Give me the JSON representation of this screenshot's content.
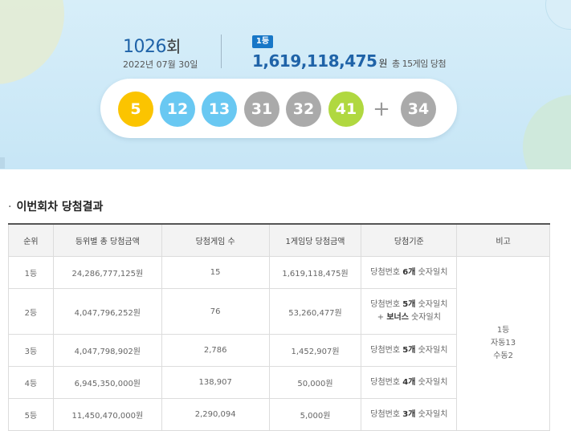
{
  "draw": {
    "number": "1026",
    "unit": "회",
    "date": "2022년 07월 30일"
  },
  "first_prize": {
    "badge": "1등",
    "amount": "1,619,118,475",
    "currency": "원",
    "games_text": "총 15게임 당첨"
  },
  "numbers": [
    {
      "value": "5",
      "color": "#fbc400"
    },
    {
      "value": "12",
      "color": "#69c8f2"
    },
    {
      "value": "13",
      "color": "#69c8f2"
    },
    {
      "value": "31",
      "color": "#aaaaaa"
    },
    {
      "value": "32",
      "color": "#aaaaaa"
    },
    {
      "value": "41",
      "color": "#b0d840"
    }
  ],
  "plus": "+",
  "bonus": {
    "value": "34",
    "color": "#aaaaaa"
  },
  "section_title": "이번회차 당첨결과",
  "section_bullet": "·",
  "table": {
    "headers": [
      "순위",
      "등위별 총 당첨금액",
      "당첨게임 수",
      "1게임당 당첨금액",
      "당첨기준",
      "비고"
    ],
    "rows": [
      {
        "rank": "1등",
        "total": "24,286,777,125원",
        "games": "15",
        "per_game": "1,619,118,475원",
        "crit_pre": "당첨번호 ",
        "crit_bold": "6개",
        "crit_post": " 숫자일치",
        "crit2_pre": "",
        "crit2_bold": "",
        "crit2_post": ""
      },
      {
        "rank": "2등",
        "total": "4,047,796,252원",
        "games": "76",
        "per_game": "53,260,477원",
        "crit_pre": "당첨번호 ",
        "crit_bold": "5개",
        "crit_post": " 숫자일치",
        "crit2_pre": "+ ",
        "crit2_bold": "보너스",
        "crit2_post": " 숫자일치"
      },
      {
        "rank": "3등",
        "total": "4,047,798,902원",
        "games": "2,786",
        "per_game": "1,452,907원",
        "crit_pre": "당첨번호 ",
        "crit_bold": "5개",
        "crit_post": " 숫자일치",
        "crit2_pre": "",
        "crit2_bold": "",
        "crit2_post": ""
      },
      {
        "rank": "4등",
        "total": "6,945,350,000원",
        "games": "138,907",
        "per_game": "50,000원",
        "crit_pre": "당첨번호 ",
        "crit_bold": "4개",
        "crit_post": " 숫자일치",
        "crit2_pre": "",
        "crit2_bold": "",
        "crit2_post": ""
      },
      {
        "rank": "5등",
        "total": "11,450,470,000원",
        "games": "2,290,094",
        "per_game": "5,000원",
        "crit_pre": "당첨번호 ",
        "crit_bold": "3개",
        "crit_post": " 숫자일치",
        "crit2_pre": "",
        "crit2_bold": "",
        "crit2_post": ""
      }
    ],
    "note": {
      "line1": "1등",
      "line2": "자동13",
      "line3": "수동2"
    }
  }
}
